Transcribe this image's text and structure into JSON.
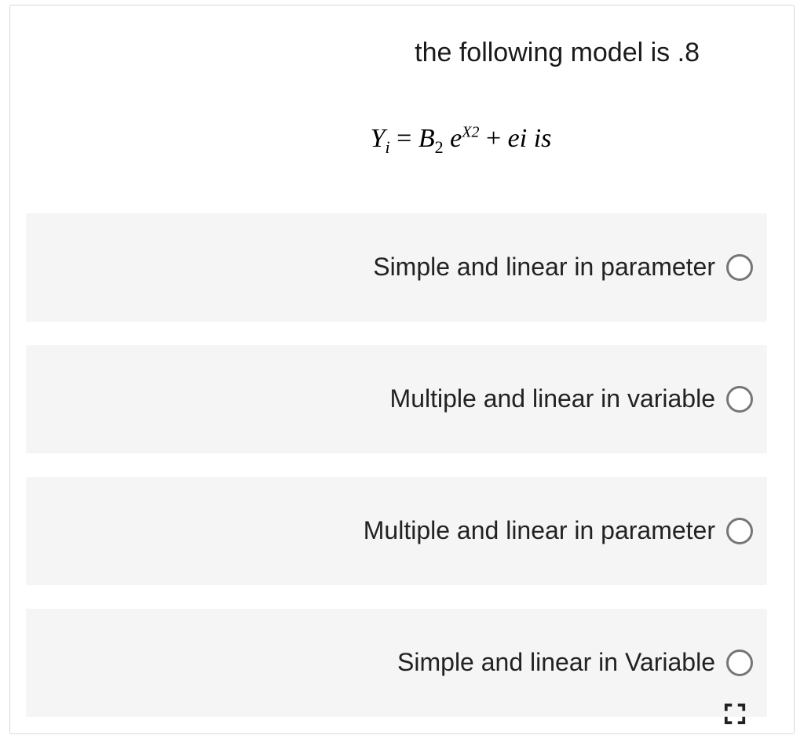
{
  "question": {
    "prompt_line": "the following model is .8",
    "equation": {
      "Y": "Y",
      "sub_i": "i",
      "eq": " = ",
      "B": "B",
      "sub_2": "2",
      "space1": " ",
      "e": "e",
      "exp_X2": "X2",
      "plus": "  + ",
      "ei": "ei",
      "is": "  is"
    }
  },
  "options": [
    {
      "label": "Simple and linear in parameter"
    },
    {
      "label": "Multiple and linear in variable"
    },
    {
      "label": "Multiple and linear in parameter"
    },
    {
      "label": "Simple and linear in Variable"
    }
  ]
}
